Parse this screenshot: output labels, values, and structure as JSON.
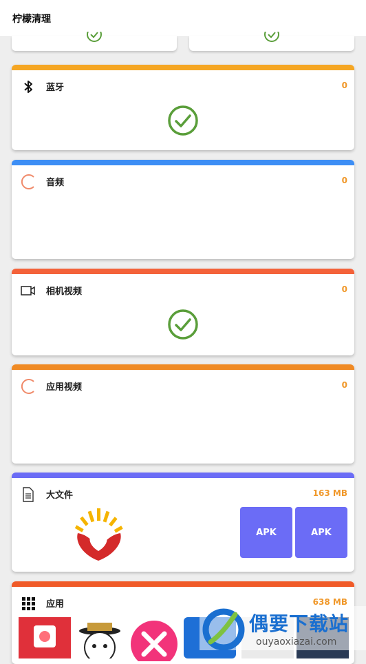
{
  "app": {
    "title": "柠檬清理"
  },
  "colors": {
    "bluetooth": "#f5a623",
    "audio": "#3d8ef5",
    "camera_video": "#f4623a",
    "app_video": "#f08a24",
    "large_files": "#6b6cf6",
    "apps": "#f05a28",
    "check_green": "#5a9e3a",
    "spinner_orange": "#f08a6a",
    "count_orange": "#f0982a"
  },
  "cards": {
    "bluetooth": {
      "label": "蓝牙",
      "count": "0",
      "icon": "bluetooth-icon",
      "status": "done"
    },
    "audio": {
      "label": "音频",
      "count": "0",
      "icon": "spinner-icon",
      "status": "scanning"
    },
    "camera_video": {
      "label": "相机视频",
      "count": "0",
      "icon": "video-camera-icon",
      "status": "done"
    },
    "app_video": {
      "label": "应用视频",
      "count": "0",
      "icon": "spinner-icon",
      "status": "scanning"
    },
    "large_files": {
      "label": "大文件",
      "size": "163 MB",
      "icon": "document-icon",
      "tiles": [
        "APK",
        "APK"
      ]
    },
    "apps": {
      "label": "应用",
      "size": "638 MB",
      "icon": "grid-icon"
    }
  },
  "watermark": {
    "text": "偶要下载站",
    "sub": "ouyaoxiazai.com"
  }
}
